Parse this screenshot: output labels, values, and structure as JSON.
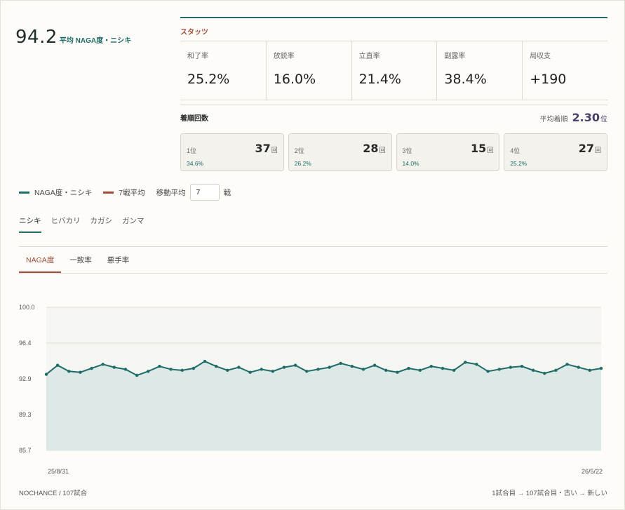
{
  "score": {
    "value": "94.2",
    "label": "平均 NAGA度・ニシキ"
  },
  "stats": {
    "title": "スタッツ",
    "items": [
      {
        "label": "和了率",
        "value": "25.2%"
      },
      {
        "label": "放銃率",
        "value": "16.0%"
      },
      {
        "label": "立直率",
        "value": "21.4%"
      },
      {
        "label": "副露率",
        "value": "38.4%"
      },
      {
        "label": "局収支",
        "value": "+190"
      }
    ]
  },
  "ranks": {
    "title": "着順回数",
    "avg_label": "平均着順",
    "avg_value": "2.30",
    "avg_unit": "位",
    "unit": "回",
    "items": [
      {
        "place": "1位",
        "count": "37",
        "pct": "34.6%"
      },
      {
        "place": "2位",
        "count": "28",
        "pct": "26.2%"
      },
      {
        "place": "3位",
        "count": "15",
        "pct": "14.0%"
      },
      {
        "place": "4位",
        "count": "27",
        "pct": "25.2%"
      }
    ]
  },
  "legend": {
    "series1": "NAGA度・ニシキ",
    "series2": "7戦平均",
    "ma_label": "移動平均",
    "ma_value": "7",
    "ma_unit": "戦",
    "series1_color": "#1f6b67",
    "series2_color": "#a14b3a"
  },
  "player_tabs": [
    "ニシキ",
    "ヒバカリ",
    "カガシ",
    "ガンマ"
  ],
  "metric_tabs": [
    "NAGA度",
    "一致率",
    "悪手率"
  ],
  "chart_data": {
    "type": "line",
    "yticks": [
      "100.0",
      "96.4",
      "92.9",
      "89.3",
      "85.7"
    ],
    "ylim": [
      85.7,
      100.0
    ],
    "x_start_label": "25/8/31",
    "x_end_label": "26/5/22",
    "series": [
      {
        "name": "NAGA度・ニシキ",
        "values": [
          93.3,
          94.2,
          93.6,
          93.5,
          93.9,
          94.3,
          94.0,
          93.8,
          93.2,
          93.6,
          94.1,
          93.8,
          93.7,
          93.9,
          94.6,
          94.1,
          93.7,
          94.0,
          93.5,
          93.8,
          93.6,
          94.0,
          94.2,
          93.6,
          93.8,
          94.0,
          94.4,
          94.1,
          93.8,
          94.2,
          93.7,
          93.5,
          93.9,
          93.7,
          94.1,
          93.9,
          93.7,
          94.5,
          94.3,
          93.6,
          93.8,
          94.0,
          94.1,
          93.7,
          93.4,
          93.7,
          94.3,
          94.0,
          93.7,
          93.9
        ]
      }
    ]
  },
  "footer": {
    "left": "NOCHANCE / 107試合",
    "right": "1試合目 → 107試合目・古い → 新しい"
  }
}
